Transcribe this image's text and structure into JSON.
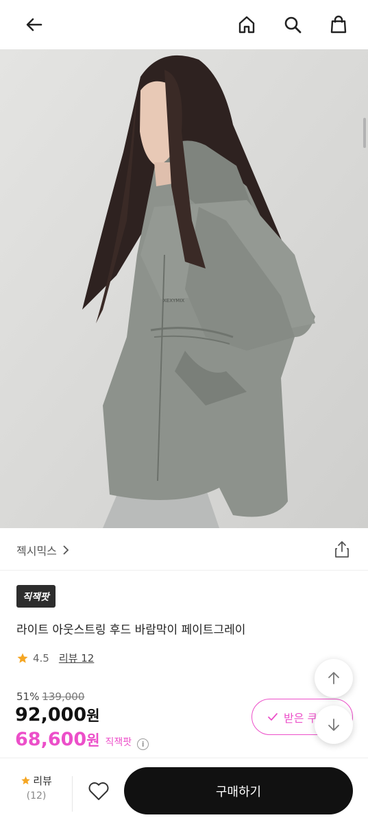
{
  "header": {
    "back_icon": "arrow-left-icon",
    "home_icon": "home-icon",
    "search_icon": "search-icon",
    "cart_icon": "shopping-bag-icon"
  },
  "hero": {
    "image_alt": "product photo",
    "logo_text": "XEXYMIX"
  },
  "brand": {
    "name": "젝시믹스",
    "share_icon": "share-icon"
  },
  "product": {
    "badge": "직잭팟",
    "title": "라이트 아웃스트링 후드 바람막이 페이트그레이",
    "rating": "4.5",
    "review_label": "리뷰 12"
  },
  "price": {
    "discount": "51%",
    "original": "139,000",
    "sale_value": "92,000",
    "sale_unit": "원",
    "special_value": "68,600",
    "special_unit": "원",
    "special_tag": "직잭팟",
    "info_icon": "i"
  },
  "coupon": {
    "label": "받은 쿠"
  },
  "floating": {
    "up_icon": "arrow-up-icon",
    "down_icon": "arrow-down-icon"
  },
  "bottom": {
    "review_label": "리뷰",
    "review_count": "(12)",
    "buy_label": "구매하기"
  },
  "colors": {
    "accent_pink": "#ec4fc9",
    "button_dark": "#111111",
    "star": "#f5a623"
  }
}
